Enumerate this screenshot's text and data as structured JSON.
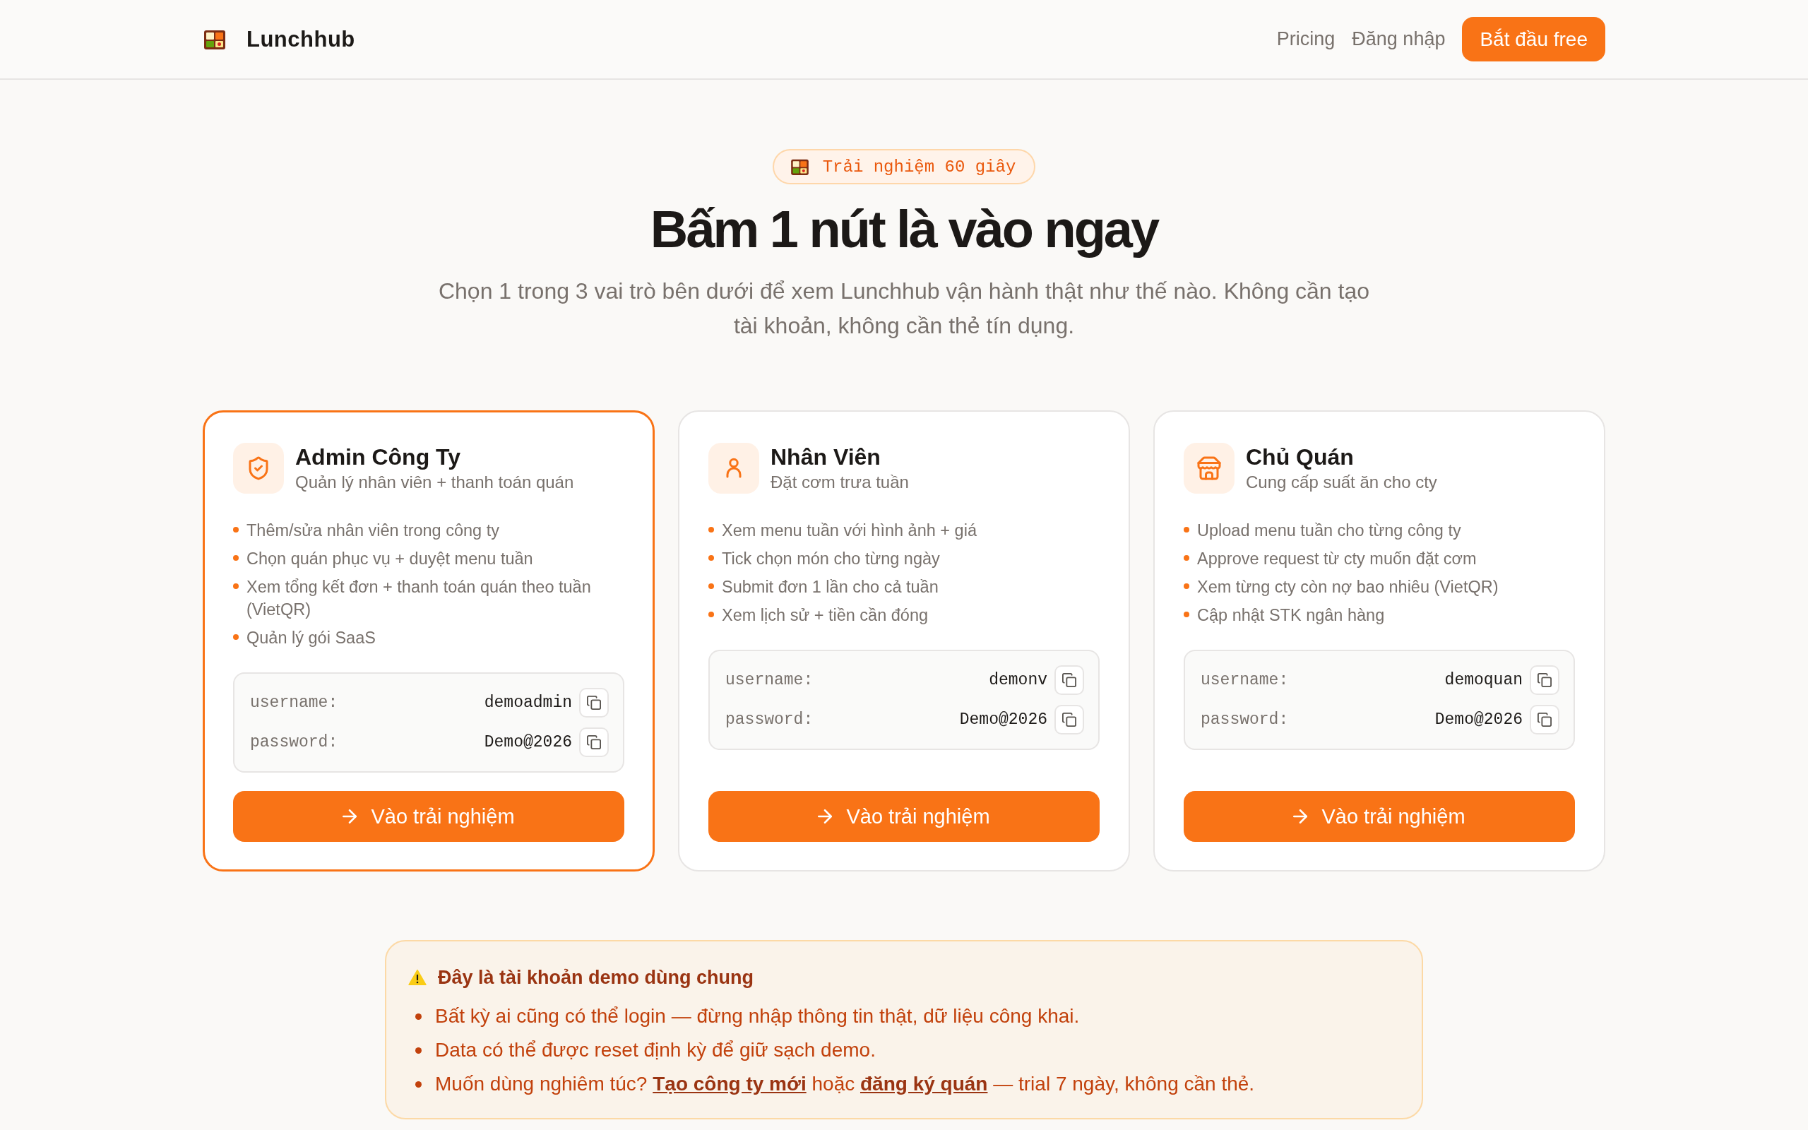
{
  "header": {
    "brand": "Lunchhub",
    "nav_links": [
      "Pricing",
      "Đăng nhập"
    ],
    "cta": "Bắt đầu free"
  },
  "hero": {
    "badge": "Trải nghiệm 60 giây",
    "title": "Bấm 1 nút là vào ngay",
    "subtitle": "Chọn 1 trong 3 vai trò bên dưới để xem Lunchhub vận hành thật như thế nào. Không cần tạo tài khoản, không cần thẻ tín dụng."
  },
  "role_cards": [
    {
      "kind": "admin",
      "selected": true,
      "title": "Admin Công Ty",
      "subtitle": "Quản lý nhân viên + thanh toán quán",
      "features": [
        "Thêm/sửa nhân viên trong công ty",
        "Chọn quán phục vụ + duyệt menu tuần",
        "Xem tổng kết đơn + thanh toán quán theo tuần (VietQR)",
        "Quản lý gói SaaS"
      ],
      "credentials": [
        {
          "label": "username:",
          "value": "demoadmin"
        },
        {
          "label": "password:",
          "value": "Demo@2026"
        }
      ],
      "button": "Vào trải nghiệm"
    },
    {
      "kind": "staff",
      "selected": false,
      "title": "Nhân Viên",
      "subtitle": "Đặt cơm trưa tuần",
      "features": [
        "Xem menu tuần với hình ảnh + giá",
        "Tick chọn món cho từng ngày",
        "Submit đơn 1 lần cho cả tuần",
        "Xem lịch sử + tiền cần đóng"
      ],
      "credentials": [
        {
          "label": "username:",
          "value": "demonv"
        },
        {
          "label": "password:",
          "value": "Demo@2026"
        }
      ],
      "button": "Vào trải nghiệm"
    },
    {
      "kind": "vendor",
      "selected": false,
      "title": "Chủ Quán",
      "subtitle": "Cung cấp suất ăn cho cty",
      "features": [
        "Upload menu tuần cho từng công ty",
        "Approve request từ cty muốn đặt cơm",
        "Xem từng cty còn nợ bao nhiêu (VietQR)",
        "Cập nhật STK ngân hàng"
      ],
      "credentials": [
        {
          "label": "username:",
          "value": "demoquan"
        },
        {
          "label": "password:",
          "value": "Demo@2026"
        }
      ],
      "button": "Vào trải nghiệm"
    }
  ],
  "notice": {
    "title": "Đây là tài khoản demo dùng chung",
    "items": [
      {
        "parts": [
          {
            "kind": "text",
            "text": "Bất kỳ ai cũng có thể login — đừng nhập thông tin thật, dữ liệu công khai."
          }
        ]
      },
      {
        "parts": [
          {
            "kind": "text",
            "text": "Data có thể được reset định kỳ để giữ sạch demo."
          }
        ]
      },
      {
        "parts": [
          {
            "kind": "text",
            "text": "Muốn dùng nghiêm túc? "
          },
          {
            "kind": "link",
            "text": "Tạo công ty mới"
          },
          {
            "kind": "text",
            "text": " hoặc "
          },
          {
            "kind": "link",
            "text": "đăng ký quán"
          },
          {
            "kind": "text",
            "text": " — trial 7 ngày, không cần thẻ."
          }
        ]
      }
    ]
  }
}
